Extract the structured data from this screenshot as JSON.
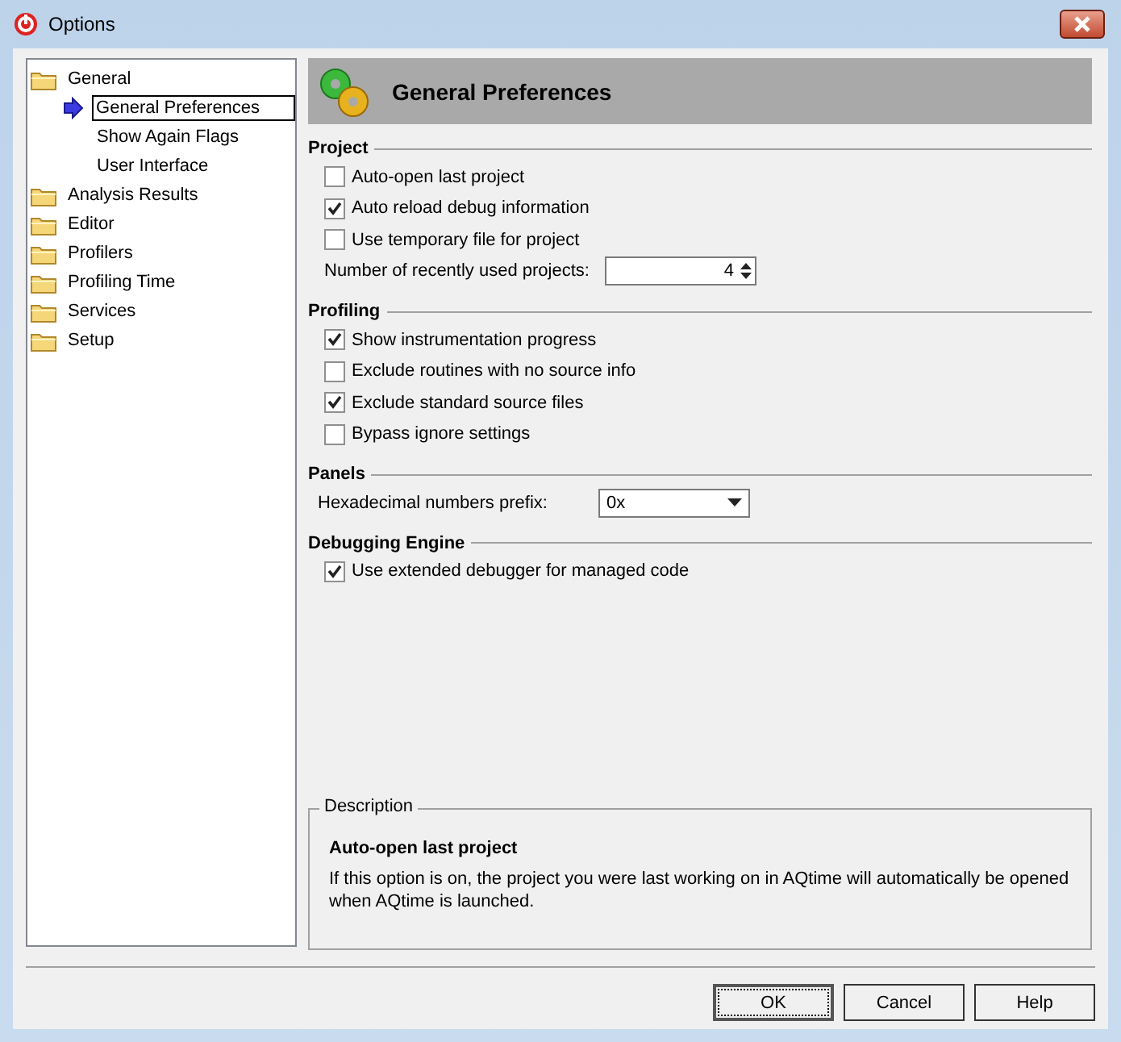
{
  "window": {
    "title": "Options"
  },
  "tree": [
    {
      "label": "General",
      "selected": false,
      "children": [
        {
          "label": "General Preferences",
          "selected": true
        },
        {
          "label": "Show Again Flags",
          "selected": false
        },
        {
          "label": "User Interface",
          "selected": false
        }
      ]
    },
    {
      "label": "Analysis Results",
      "selected": false
    },
    {
      "label": "Editor",
      "selected": false
    },
    {
      "label": "Profilers",
      "selected": false
    },
    {
      "label": "Profiling Time",
      "selected": false
    },
    {
      "label": "Services",
      "selected": false
    },
    {
      "label": "Setup",
      "selected": false
    }
  ],
  "page_title": "General Preferences",
  "sections": [
    {
      "title": "Project",
      "items": [
        {
          "kind": "checkbox",
          "label": "Auto-open last project",
          "checked": false
        },
        {
          "kind": "checkbox",
          "label": "Auto reload debug information",
          "checked": true
        },
        {
          "kind": "checkbox",
          "label": "Use temporary file for project",
          "checked": false
        },
        {
          "kind": "spinner",
          "label": "Number of recently used projects:",
          "value": "4"
        }
      ]
    },
    {
      "title": "Profiling",
      "items": [
        {
          "kind": "checkbox",
          "label": "Show instrumentation progress",
          "checked": true
        },
        {
          "kind": "checkbox",
          "label": "Exclude routines with no source info",
          "checked": false
        },
        {
          "kind": "checkbox",
          "label": "Exclude standard source files",
          "checked": true
        },
        {
          "kind": "checkbox",
          "label": "Bypass ignore settings",
          "checked": false
        }
      ]
    },
    {
      "title": "Panels",
      "items": [
        {
          "kind": "dropdown",
          "label": "Hexadecimal numbers prefix:",
          "value": "0x"
        }
      ]
    },
    {
      "title": "Debugging Engine",
      "items": [
        {
          "kind": "checkbox",
          "label": "Use extended debugger for managed code",
          "checked": true
        }
      ]
    }
  ],
  "description": {
    "legend": "Description",
    "heading": "Auto-open last project",
    "text": "If this option is on, the project you were last working on in AQtime will automatically be opened when AQtime is launched."
  },
  "buttons": [
    {
      "label": "OK",
      "default": true
    },
    {
      "label": "Cancel",
      "default": false
    },
    {
      "label": "Help",
      "default": false
    }
  ]
}
